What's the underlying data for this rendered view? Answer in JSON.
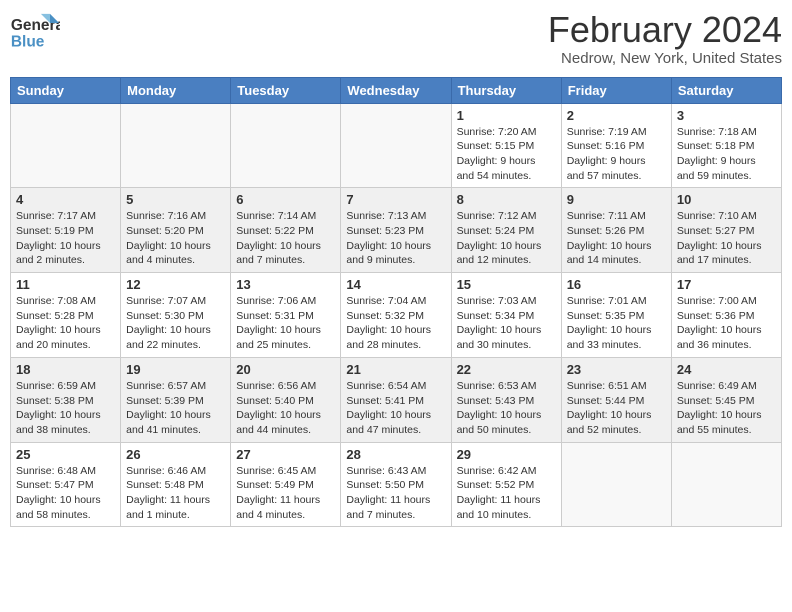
{
  "header": {
    "logo_line1": "General",
    "logo_line2": "Blue",
    "month_year": "February 2024",
    "location": "Nedrow, New York, United States"
  },
  "days_of_week": [
    "Sunday",
    "Monday",
    "Tuesday",
    "Wednesday",
    "Thursday",
    "Friday",
    "Saturday"
  ],
  "weeks": [
    {
      "days": [
        {
          "num": "",
          "empty": true
        },
        {
          "num": "",
          "empty": true
        },
        {
          "num": "",
          "empty": true
        },
        {
          "num": "",
          "empty": true
        },
        {
          "num": "1",
          "sunrise": "Sunrise: 7:20 AM",
          "sunset": "Sunset: 5:15 PM",
          "daylight": "Daylight: 9 hours and 54 minutes."
        },
        {
          "num": "2",
          "sunrise": "Sunrise: 7:19 AM",
          "sunset": "Sunset: 5:16 PM",
          "daylight": "Daylight: 9 hours and 57 minutes."
        },
        {
          "num": "3",
          "sunrise": "Sunrise: 7:18 AM",
          "sunset": "Sunset: 5:18 PM",
          "daylight": "Daylight: 9 hours and 59 minutes."
        }
      ]
    },
    {
      "days": [
        {
          "num": "4",
          "sunrise": "Sunrise: 7:17 AM",
          "sunset": "Sunset: 5:19 PM",
          "daylight": "Daylight: 10 hours and 2 minutes."
        },
        {
          "num": "5",
          "sunrise": "Sunrise: 7:16 AM",
          "sunset": "Sunset: 5:20 PM",
          "daylight": "Daylight: 10 hours and 4 minutes."
        },
        {
          "num": "6",
          "sunrise": "Sunrise: 7:14 AM",
          "sunset": "Sunset: 5:22 PM",
          "daylight": "Daylight: 10 hours and 7 minutes."
        },
        {
          "num": "7",
          "sunrise": "Sunrise: 7:13 AM",
          "sunset": "Sunset: 5:23 PM",
          "daylight": "Daylight: 10 hours and 9 minutes."
        },
        {
          "num": "8",
          "sunrise": "Sunrise: 7:12 AM",
          "sunset": "Sunset: 5:24 PM",
          "daylight": "Daylight: 10 hours and 12 minutes."
        },
        {
          "num": "9",
          "sunrise": "Sunrise: 7:11 AM",
          "sunset": "Sunset: 5:26 PM",
          "daylight": "Daylight: 10 hours and 14 minutes."
        },
        {
          "num": "10",
          "sunrise": "Sunrise: 7:10 AM",
          "sunset": "Sunset: 5:27 PM",
          "daylight": "Daylight: 10 hours and 17 minutes."
        }
      ]
    },
    {
      "days": [
        {
          "num": "11",
          "sunrise": "Sunrise: 7:08 AM",
          "sunset": "Sunset: 5:28 PM",
          "daylight": "Daylight: 10 hours and 20 minutes."
        },
        {
          "num": "12",
          "sunrise": "Sunrise: 7:07 AM",
          "sunset": "Sunset: 5:30 PM",
          "daylight": "Daylight: 10 hours and 22 minutes."
        },
        {
          "num": "13",
          "sunrise": "Sunrise: 7:06 AM",
          "sunset": "Sunset: 5:31 PM",
          "daylight": "Daylight: 10 hours and 25 minutes."
        },
        {
          "num": "14",
          "sunrise": "Sunrise: 7:04 AM",
          "sunset": "Sunset: 5:32 PM",
          "daylight": "Daylight: 10 hours and 28 minutes."
        },
        {
          "num": "15",
          "sunrise": "Sunrise: 7:03 AM",
          "sunset": "Sunset: 5:34 PM",
          "daylight": "Daylight: 10 hours and 30 minutes."
        },
        {
          "num": "16",
          "sunrise": "Sunrise: 7:01 AM",
          "sunset": "Sunset: 5:35 PM",
          "daylight": "Daylight: 10 hours and 33 minutes."
        },
        {
          "num": "17",
          "sunrise": "Sunrise: 7:00 AM",
          "sunset": "Sunset: 5:36 PM",
          "daylight": "Daylight: 10 hours and 36 minutes."
        }
      ]
    },
    {
      "days": [
        {
          "num": "18",
          "sunrise": "Sunrise: 6:59 AM",
          "sunset": "Sunset: 5:38 PM",
          "daylight": "Daylight: 10 hours and 38 minutes."
        },
        {
          "num": "19",
          "sunrise": "Sunrise: 6:57 AM",
          "sunset": "Sunset: 5:39 PM",
          "daylight": "Daylight: 10 hours and 41 minutes."
        },
        {
          "num": "20",
          "sunrise": "Sunrise: 6:56 AM",
          "sunset": "Sunset: 5:40 PM",
          "daylight": "Daylight: 10 hours and 44 minutes."
        },
        {
          "num": "21",
          "sunrise": "Sunrise: 6:54 AM",
          "sunset": "Sunset: 5:41 PM",
          "daylight": "Daylight: 10 hours and 47 minutes."
        },
        {
          "num": "22",
          "sunrise": "Sunrise: 6:53 AM",
          "sunset": "Sunset: 5:43 PM",
          "daylight": "Daylight: 10 hours and 50 minutes."
        },
        {
          "num": "23",
          "sunrise": "Sunrise: 6:51 AM",
          "sunset": "Sunset: 5:44 PM",
          "daylight": "Daylight: 10 hours and 52 minutes."
        },
        {
          "num": "24",
          "sunrise": "Sunrise: 6:49 AM",
          "sunset": "Sunset: 5:45 PM",
          "daylight": "Daylight: 10 hours and 55 minutes."
        }
      ]
    },
    {
      "days": [
        {
          "num": "25",
          "sunrise": "Sunrise: 6:48 AM",
          "sunset": "Sunset: 5:47 PM",
          "daylight": "Daylight: 10 hours and 58 minutes."
        },
        {
          "num": "26",
          "sunrise": "Sunrise: 6:46 AM",
          "sunset": "Sunset: 5:48 PM",
          "daylight": "Daylight: 11 hours and 1 minute."
        },
        {
          "num": "27",
          "sunrise": "Sunrise: 6:45 AM",
          "sunset": "Sunset: 5:49 PM",
          "daylight": "Daylight: 11 hours and 4 minutes."
        },
        {
          "num": "28",
          "sunrise": "Sunrise: 6:43 AM",
          "sunset": "Sunset: 5:50 PM",
          "daylight": "Daylight: 11 hours and 7 minutes."
        },
        {
          "num": "29",
          "sunrise": "Sunrise: 6:42 AM",
          "sunset": "Sunset: 5:52 PM",
          "daylight": "Daylight: 11 hours and 10 minutes."
        },
        {
          "num": "",
          "empty": true
        },
        {
          "num": "",
          "empty": true
        }
      ]
    }
  ]
}
